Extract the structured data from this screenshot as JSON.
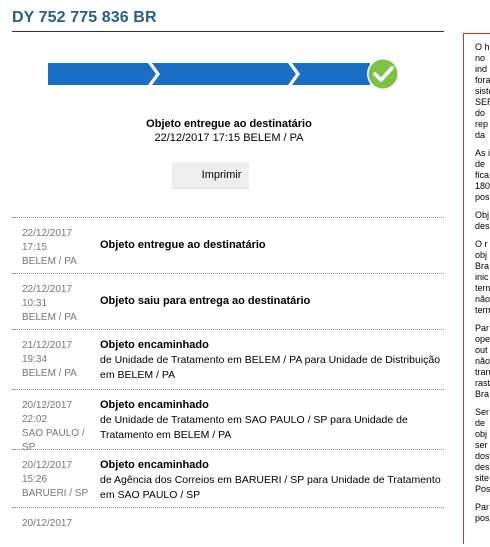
{
  "tracking_code": "DY 752 775 836 BR",
  "summary": {
    "status": "Objeto entregue ao destinatário",
    "date": "22/12/2017",
    "time": "17:15",
    "location": "BELEM / PA"
  },
  "progress": {
    "completed_fraction": 1.0,
    "check_icon": "check-circle-icon",
    "bar_color": "#1a6fc4",
    "check_color": "#7dc243"
  },
  "print_label": "Imprimir",
  "events": [
    {
      "date": "22/12/2017",
      "time": "17:15",
      "place": "BELEM / PA",
      "status": "Objeto entregue ao destinatário",
      "detail": ""
    },
    {
      "date": "22/12/2017",
      "time": "10:31",
      "place": "BELEM / PA",
      "status": "Objeto saiu para entrega ao destinatário",
      "detail": ""
    },
    {
      "date": "21/12/2017",
      "time": "19:34",
      "place": "BELEM / PA",
      "status": "Objeto encaminhado",
      "detail": "de Unidade de Tratamento em BELEM / PA para Unidade de Distribuição em BELEM / PA"
    },
    {
      "date": "20/12/2017",
      "time": "22:02",
      "place": "SAO PAULO / SP",
      "status": "Objeto encaminhado",
      "detail": "de Unidade de Tratamento em SAO PAULO / SP para Unidade de Tratamento em BELEM / PA"
    },
    {
      "date": "20/12/2017",
      "time": "15:26",
      "place": "BARUERI / SP",
      "status": "Objeto encaminhado",
      "detail": "de Agência dos Correios em BARUERI / SP para Unidade de Tratamento em SAO PAULO / SP"
    },
    {
      "date": "20/12/2017",
      "time": "",
      "place": "",
      "status": "",
      "detail": ""
    }
  ],
  "sidebar_fragments": [
    [
      "O h",
      "no",
      "ind",
      "fora",
      "siste",
      "SER",
      "do",
      "rep",
      "da"
    ],
    [
      "As i",
      "de",
      "fica",
      "180",
      "pos"
    ],
    [
      "Obj",
      "des"
    ],
    [
      "O r",
      "obj",
      "Bra",
      "inic",
      "term",
      "não",
      "term"
    ],
    [
      "Par",
      "ope",
      "out",
      "não",
      "tran",
      "rast",
      "Bra"
    ],
    [
      "Ser",
      "de",
      "obj",
      "ser",
      "dos",
      "des",
      "site",
      "Pos"
    ],
    [
      "Par",
      "pos"
    ]
  ]
}
